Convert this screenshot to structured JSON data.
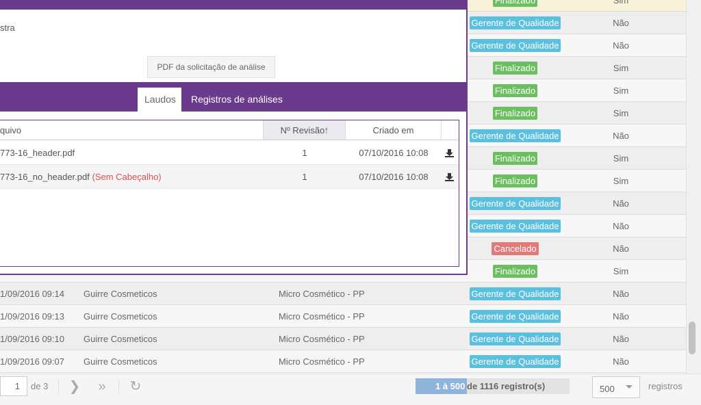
{
  "colors": {
    "purple": "#6a3a8c",
    "badge_blue": "#5bc0de",
    "badge_green": "#6cbf61",
    "badge_red": "#e07b7b",
    "yes_green": "#6cbf61",
    "no_red": "#d9534f",
    "first_row_bg": "#f8f2d8"
  },
  "background_table": {
    "rows": [
      {
        "date": "",
        "client": "",
        "type": "",
        "status": "Finalizado",
        "status_kind": "green",
        "flag": "Sim"
      },
      {
        "date": "",
        "client": "",
        "type": "",
        "status": "Gerente de Qualidade",
        "status_kind": "blue",
        "flag": "Não"
      },
      {
        "date": "",
        "client": "",
        "type": "",
        "status": "Gerente de Qualidade",
        "status_kind": "blue",
        "flag": "Não"
      },
      {
        "date": "",
        "client": "",
        "type": "",
        "status": "Finalizado",
        "status_kind": "green",
        "flag": "Sim"
      },
      {
        "date": "",
        "client": "",
        "type": "",
        "status": "Finalizado",
        "status_kind": "green",
        "flag": "Sim"
      },
      {
        "date": "",
        "client": "",
        "type": "",
        "status": "Finalizado",
        "status_kind": "green",
        "flag": "Sim"
      },
      {
        "date": "",
        "client": "",
        "type": "",
        "status": "Gerente de Qualidade",
        "status_kind": "blue",
        "flag": "Não"
      },
      {
        "date": "",
        "client": "",
        "type": "",
        "status": "Finalizado",
        "status_kind": "green",
        "flag": "Sim"
      },
      {
        "date": "",
        "client": "",
        "type": "",
        "status": "Finalizado",
        "status_kind": "green",
        "flag": "Sim"
      },
      {
        "date": "",
        "client": "",
        "type": "",
        "status": "Gerente de Qualidade",
        "status_kind": "blue",
        "flag": "Não"
      },
      {
        "date": "",
        "client": "",
        "type": "",
        "status": "Gerente de Qualidade",
        "status_kind": "blue",
        "flag": "Não"
      },
      {
        "date": "",
        "client": "",
        "type": "",
        "status": "Cancelado",
        "status_kind": "red",
        "flag": "Não"
      },
      {
        "date": "",
        "client": "",
        "type": "",
        "status": "Finalizado",
        "status_kind": "green",
        "flag": "Sim"
      },
      {
        "date": "1/09/2016 09:14",
        "client": "Guirre Cosmeticos",
        "type": "Micro Cosmético - PP",
        "status": "Gerente de Qualidade",
        "status_kind": "blue",
        "flag": "Não"
      },
      {
        "date": "1/09/2016 09:13",
        "client": "Guirre Cosmeticos",
        "type": "Micro Cosmético - PP",
        "status": "Gerente de Qualidade",
        "status_kind": "blue",
        "flag": "Não"
      },
      {
        "date": "1/09/2016 09:10",
        "client": "Guirre Cosmeticos",
        "type": "Micro Cosmético - PP",
        "status": "Gerente de Qualidade",
        "status_kind": "blue",
        "flag": "Não"
      },
      {
        "date": "1/09/2016 09:07",
        "client": "Guirre Cosmeticos",
        "type": "Micro Cosmético - PP",
        "status": "Gerente de Qualidade",
        "status_kind": "blue",
        "flag": "Não"
      }
    ]
  },
  "modal": {
    "text_fragment": "stra",
    "pdf_button_label": "PDF da solicitação de análise",
    "tabs": [
      {
        "label": "Laudos",
        "active": true
      },
      {
        "label": "Registros de análises",
        "active": false
      }
    ],
    "grid": {
      "headers": {
        "file": "quivo",
        "revision": "Nº Revisão",
        "created": "Criado em"
      },
      "rows": [
        {
          "file": "773-16_header.pdf",
          "suffix": "",
          "revision": "1",
          "created": "07/10/2016 10:08",
          "icon": "download-icon"
        },
        {
          "file": "773-16_no_header.pdf",
          "suffix": "(Sem Cabeçalho)",
          "revision": "1",
          "created": "07/10/2016 10:08",
          "icon": "download-icon"
        }
      ]
    }
  },
  "pagination": {
    "page_value": "1",
    "of_label": "de 3",
    "range_start": "1 à 500",
    "range_rest": "de 1116 registro(s)",
    "range_fill_fraction": 0.333,
    "per_page_value": "500",
    "per_page_label": "registros",
    "icons": [
      "next-page-icon",
      "last-page-icon",
      "refresh-icon"
    ]
  }
}
